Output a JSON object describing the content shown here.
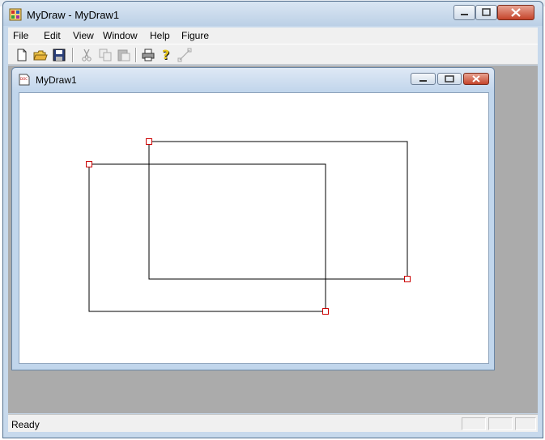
{
  "window": {
    "title": "MyDraw - MyDraw1"
  },
  "menu": [
    "File",
    "Edit",
    "View",
    "Window",
    "Help",
    "Figure"
  ],
  "toolbar": {
    "buttons": [
      "new-file-icon",
      "open-folder-icon",
      "save-icon",
      "cut-icon",
      "copy-icon",
      "paste-icon",
      "print-icon",
      "help-icon",
      "resize-icon"
    ]
  },
  "child_window": {
    "title": "MyDraw1"
  },
  "canvas": {
    "rectangles": [
      {
        "name": "rectangle-1",
        "handles": [
          "top-left",
          "bottom-right"
        ]
      },
      {
        "name": "rectangle-2",
        "handles": [
          "top-left",
          "bottom-right"
        ]
      }
    ]
  },
  "status": {
    "text": "Ready"
  },
  "colors": {
    "handle": "#cc0000",
    "titlebar": "#c7d9ec",
    "mdi_bg": "#ababab"
  }
}
